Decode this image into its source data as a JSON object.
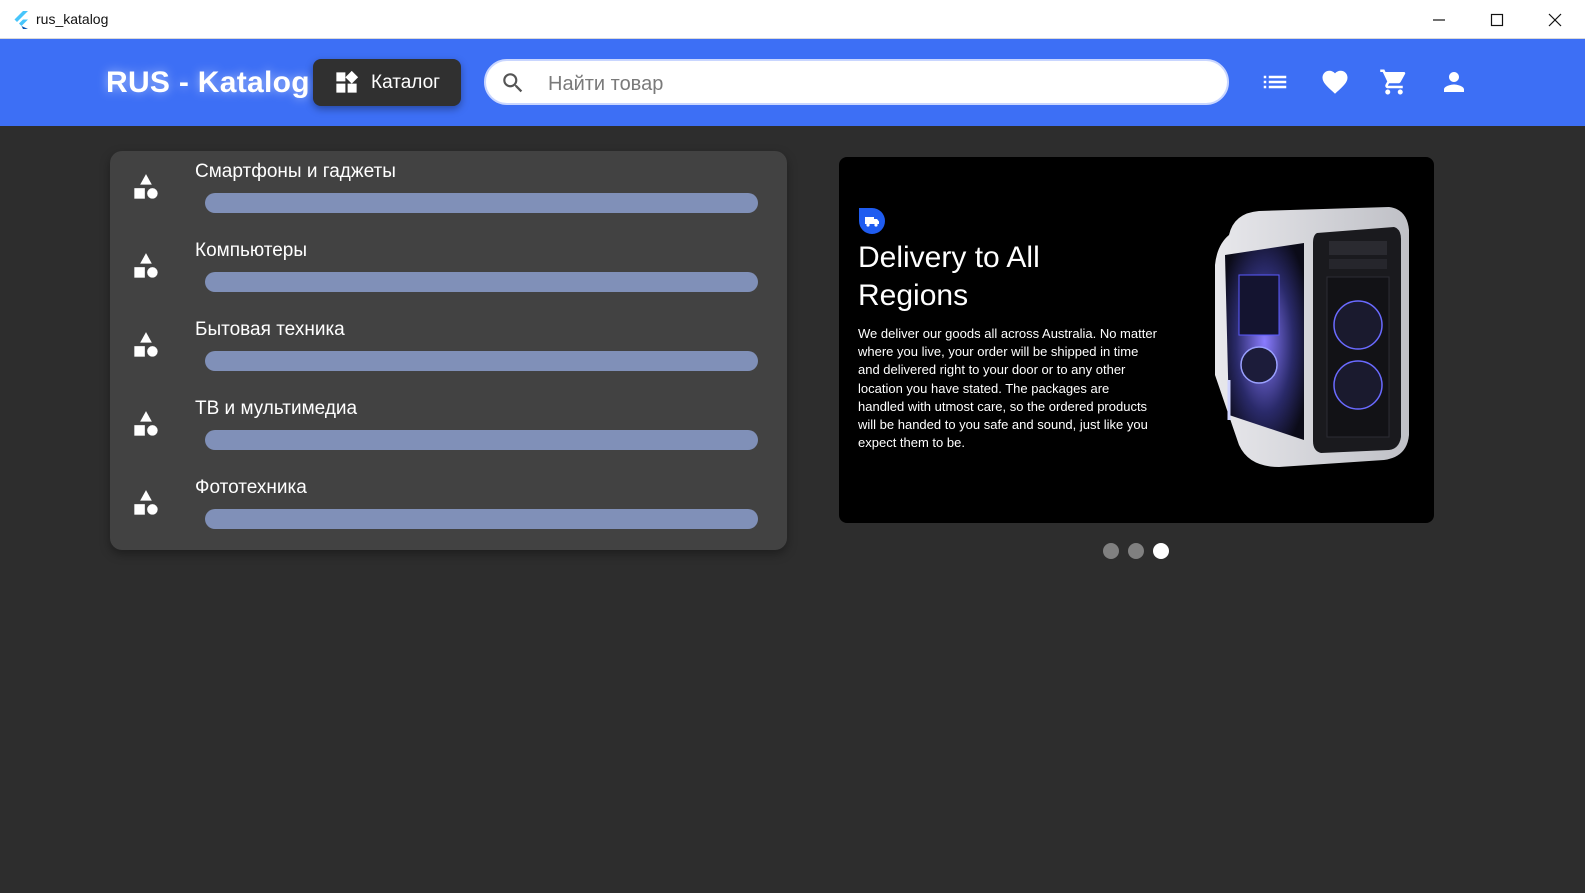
{
  "window": {
    "title": "rus_katalog"
  },
  "header": {
    "brand": "RUS - Katalog",
    "catalog_button": "Каталог",
    "search_placeholder": "Найти товар",
    "icons": [
      "list-icon",
      "heart-icon",
      "cart-icon",
      "person-icon"
    ]
  },
  "categories": [
    {
      "label": "Смартфоны и гаджеты"
    },
    {
      "label": "Компьютеры"
    },
    {
      "label": "Бытовая техника"
    },
    {
      "label": "ТВ и мультимедиа"
    },
    {
      "label": "Фототехника"
    }
  ],
  "banner": {
    "title": "Delivery to All Regions",
    "text": "We deliver our goods all across Australia. No matter where you live, your order will be shipped in time and delivered right to your door or to any other location you have stated. The packages are handled with utmost care, so the ordered products will be handed to you safe and sound, just like you expect them to be.",
    "slide_count": 3,
    "active_slide": 3
  },
  "colors": {
    "appbar": "#3d6ff5",
    "background": "#2d2d2d",
    "panel": "#424242",
    "category_bar": "#8090b8",
    "badge": "#1f5cf0"
  }
}
